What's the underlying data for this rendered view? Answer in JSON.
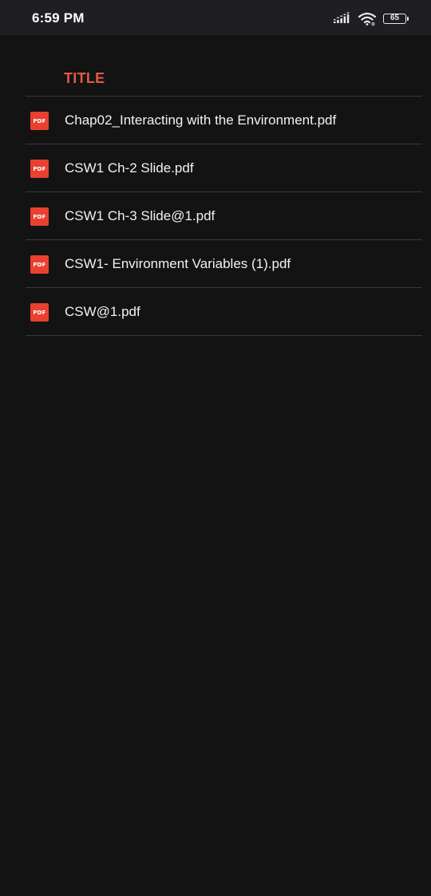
{
  "status_bar": {
    "time": "6:59 PM",
    "battery_level": "65",
    "icons": [
      "signal-icon",
      "wifi-icon",
      "battery-icon"
    ]
  },
  "list": {
    "header_title": "TITLE",
    "icon_label": "PDF",
    "files": [
      {
        "name": "Chap02_Interacting with the Environment.pdf"
      },
      {
        "name": "CSW1 Ch-2 Slide.pdf"
      },
      {
        "name": "CSW1 Ch-3 Slide@1.pdf"
      },
      {
        "name": "CSW1- Environment Variables (1).pdf"
      },
      {
        "name": "CSW@1.pdf"
      }
    ]
  },
  "colors": {
    "background": "#131313",
    "status_bar": "#1f1f23",
    "accent": "#e05a45",
    "pdf_icon": "#e8412f",
    "divider": "#3a3a3a"
  }
}
